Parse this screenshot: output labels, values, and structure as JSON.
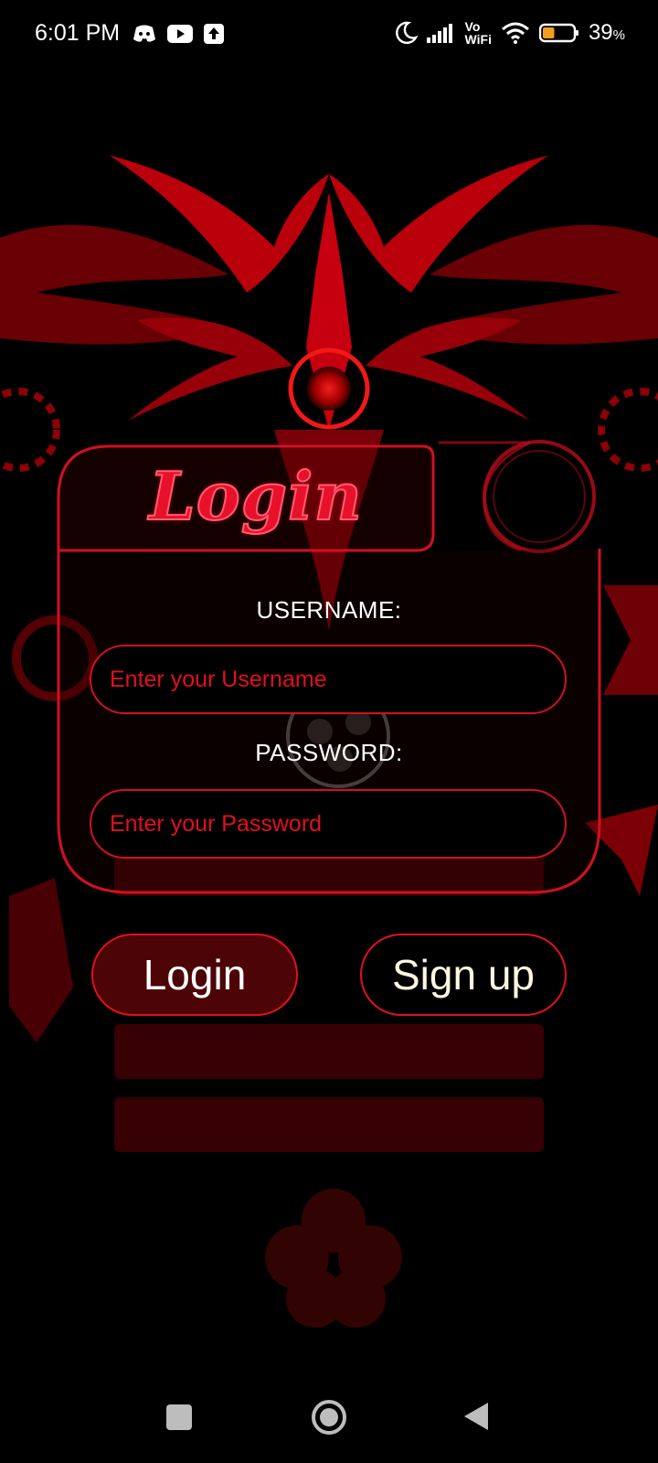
{
  "status_bar": {
    "time": "6:01 PM",
    "left_icons": [
      "discord-icon",
      "youtube-icon",
      "upload-icon"
    ],
    "right_icons": [
      "moon-icon",
      "signal-icon",
      "vowifi-icon",
      "wifi-icon",
      "battery-icon"
    ],
    "vowifi_top": "Vo",
    "vowifi_bottom": "WiFi",
    "battery_percent": "39",
    "battery_unit": "%",
    "battery_level": 0.39
  },
  "login_card": {
    "title": "Login",
    "username_label": "USERNAME:",
    "username_placeholder": "Enter your Username",
    "username_value": "",
    "password_label": "PASSWORD:",
    "password_placeholder": "Enter your Password",
    "password_value": ""
  },
  "actions": {
    "login_label": "Login",
    "signup_label": "Sign up"
  },
  "nav_bar": {
    "buttons": [
      "recents-square-icon",
      "home-circle-icon",
      "back-triangle-icon"
    ]
  },
  "colors": {
    "accent": "#e01020",
    "background": "#000000",
    "login_button_bg": "#4d0406"
  }
}
